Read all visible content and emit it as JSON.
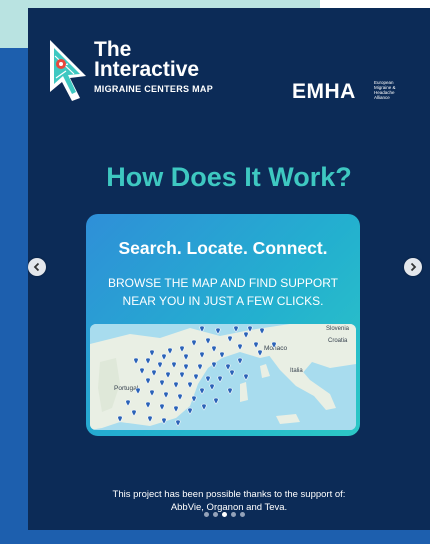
{
  "logo": {
    "title_line1": "The",
    "title_line2": "Interactive",
    "subtitle": "MIGRAINE CENTERS MAP",
    "icon": "map-cursor-icon"
  },
  "partner": {
    "name": "EMHA",
    "tagline": "European Migraine & Headache Alliance"
  },
  "headline": "How Does It Work?",
  "card": {
    "title": "Search. Locate. Connect.",
    "description_line1": "BROWSE THE MAP AND FIND SUPPORT",
    "description_line2": "NEAR YOU IN JUST A FEW CLICKS."
  },
  "map_labels": {
    "monaco": "Monaco",
    "portugal": "Portugal",
    "italia": "Italia",
    "slovenia": "Slovenia",
    "croatia": "Croatia"
  },
  "footer": {
    "line1": "This project has been possible thanks to the support of:",
    "line2": "AbbVie, Organon and Teva."
  },
  "carousel": {
    "total_slides": 5,
    "active_index": 2,
    "prev_icon": "chevron-left-icon",
    "next_icon": "chevron-right-icon"
  },
  "colors": {
    "slide_background": "#0c2b57",
    "accent_teal": "#3ec8c1",
    "card_gradient_start": "#2f8fd8",
    "card_gradient_end": "#2dc8c5",
    "pin": "#2b63b8"
  }
}
